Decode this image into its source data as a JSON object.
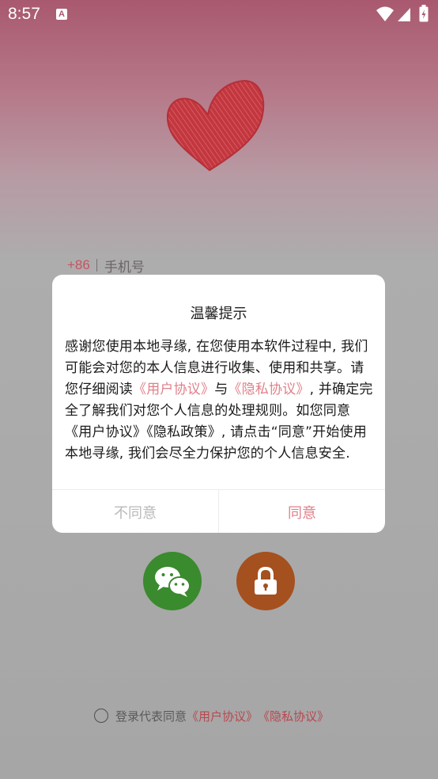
{
  "status_bar": {
    "time": "8:57",
    "notification_icon": "A"
  },
  "login": {
    "country_code": "+86",
    "phone_placeholder": "手机号",
    "wechat_icon": "wechat-icon",
    "lock_icon": "lock-icon"
  },
  "agreement": {
    "prefix": "登录代表同意",
    "user_agreement": "《用户协议》",
    "privacy_agreement": "《隐私协议》"
  },
  "dialog": {
    "title": "温馨提示",
    "body_part1": "感谢您使用本地寻缘, 在您使用本软件过程中, 我们可能会对您的本人信息进行收集、使用和共享。请您仔细阅读",
    "link_user": "《用户协议》",
    "and": "与",
    "link_privacy": "《隐私协议》",
    "body_part2": ", 并确定完全了解我们对您个人信息的处理规则。如您同意《用户协议》《隐私政策》, 请点击“同意”开始使用本地寻缘, 我们会尽全力保护您的个人信息安全.",
    "disagree_label": "不同意",
    "agree_label": "同意"
  },
  "colors": {
    "accent": "#e0808a",
    "wechat": "#3a8a2e",
    "lock": "#a5501f"
  }
}
